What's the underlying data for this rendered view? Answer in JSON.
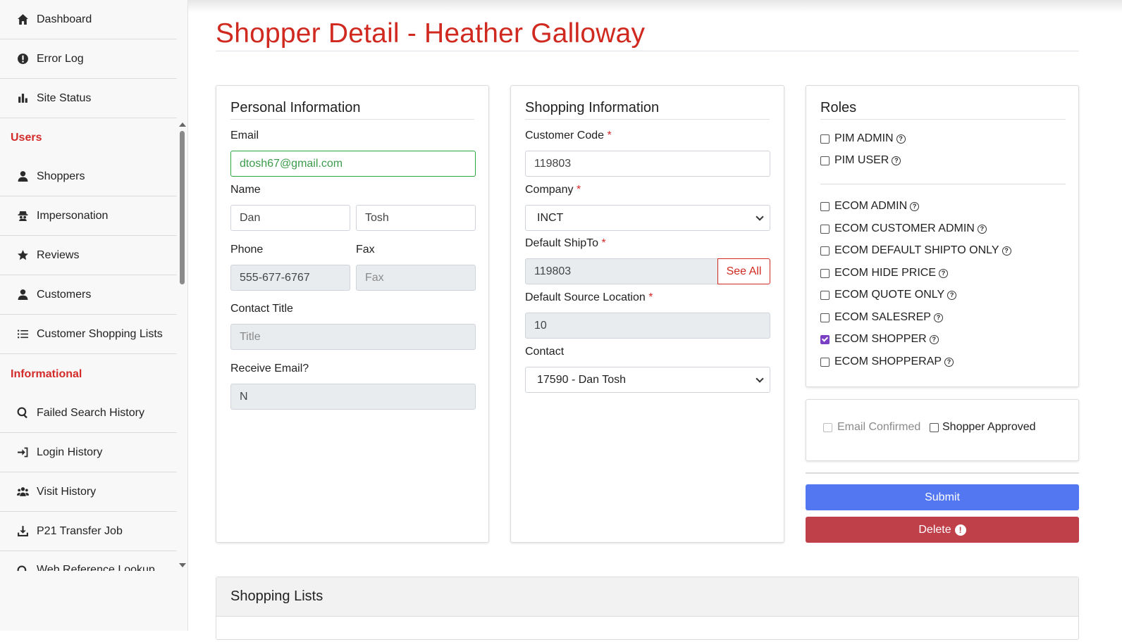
{
  "sidebar": {
    "items_top": [
      {
        "label": "Dashboard",
        "icon": "home-icon"
      },
      {
        "label": "Error Log",
        "icon": "alert-circle-icon"
      },
      {
        "label": "Site Status",
        "icon": "bar-chart-icon"
      }
    ],
    "section_users": "Users",
    "items_users": [
      {
        "label": "Shoppers",
        "icon": "user-icon"
      },
      {
        "label": "Impersonation",
        "icon": "spy-icon"
      },
      {
        "label": "Reviews",
        "icon": "star-icon"
      },
      {
        "label": "Customers",
        "icon": "user-icon"
      },
      {
        "label": "Customer Shopping Lists",
        "icon": "list-icon"
      }
    ],
    "section_info": "Informational",
    "items_info": [
      {
        "label": "Failed Search History",
        "icon": "search-icon"
      },
      {
        "label": "Login History",
        "icon": "sign-in-icon"
      },
      {
        "label": "Visit History",
        "icon": "users-icon"
      },
      {
        "label": "P21 Transfer Job",
        "icon": "download-icon"
      },
      {
        "label": "Web Reference Lookup",
        "icon": "search-icon"
      }
    ]
  },
  "page": {
    "title": "Shopper Detail - Heather Galloway"
  },
  "personal": {
    "title": "Personal Information",
    "email_label": "Email",
    "email_value": "dtosh67@gmail.com",
    "name_label": "Name",
    "first_name": "Dan",
    "last_name": "Tosh",
    "phone_label": "Phone",
    "phone_value": "555-677-6767",
    "fax_label": "Fax",
    "fax_placeholder": "Fax",
    "contact_title_label": "Contact Title",
    "contact_title_placeholder": "Title",
    "receive_email_label": "Receive Email?",
    "receive_email_value": "N"
  },
  "shopping": {
    "title": "Shopping Information",
    "customer_code_label": "Customer Code",
    "customer_code_value": "119803",
    "company_label": "Company",
    "company_value": "INCT",
    "shipto_label": "Default ShipTo",
    "shipto_value": "119803",
    "see_all": "See All",
    "source_label": "Default Source Location",
    "source_value": "10",
    "contact_label": "Contact",
    "contact_value": "17590 - Dan Tosh",
    "required_mark": "*"
  },
  "roles": {
    "title": "Roles",
    "pim": [
      {
        "label": "PIM ADMIN",
        "checked": false
      },
      {
        "label": "PIM USER",
        "checked": false
      }
    ],
    "ecom": [
      {
        "label": "ECOM ADMIN",
        "checked": false
      },
      {
        "label": "ECOM CUSTOMER ADMIN",
        "checked": false
      },
      {
        "label": "ECOM DEFAULT SHIPTO ONLY",
        "checked": false
      },
      {
        "label": "ECOM HIDE PRICE",
        "checked": false
      },
      {
        "label": "ECOM QUOTE ONLY",
        "checked": false
      },
      {
        "label": "ECOM SALESREP",
        "checked": false
      },
      {
        "label": "ECOM SHOPPER",
        "checked": true
      },
      {
        "label": "ECOM SHOPPERAP",
        "checked": false
      }
    ]
  },
  "status": {
    "email_confirmed": "Email Confirmed",
    "shopper_approved": "Shopper Approved"
  },
  "actions": {
    "submit": "Submit",
    "delete": "Delete"
  },
  "lists": {
    "title": "Shopping Lists"
  },
  "colors": {
    "accent_red": "#d0291f",
    "submit_blue": "#5277f0",
    "delete_red": "#c0404a",
    "checked_purple": "#7b3fc4"
  }
}
